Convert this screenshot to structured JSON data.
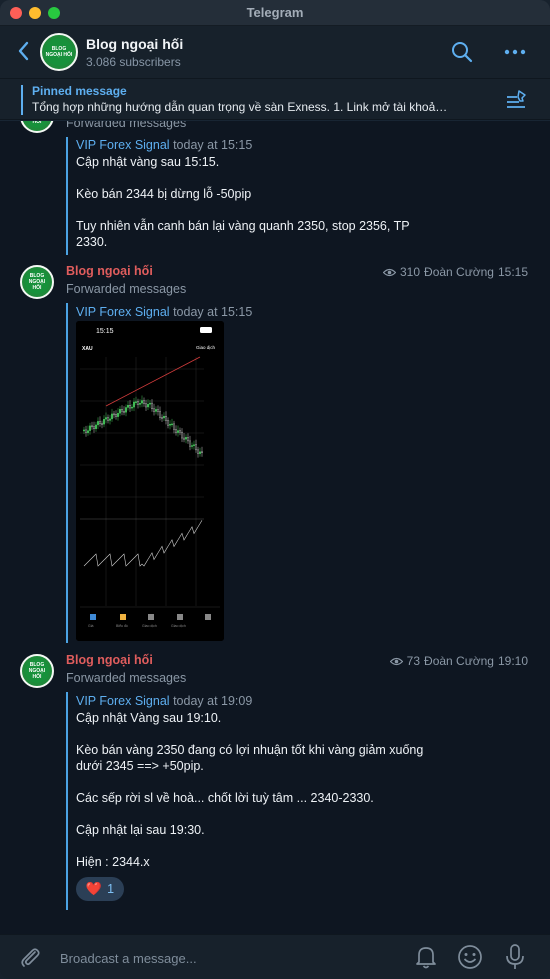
{
  "window": {
    "title": "Telegram"
  },
  "header": {
    "channel_name": "Blog ngoại hối",
    "subscribers": "3.086 subscribers",
    "avatar_text": "BLOG NGOẠI HỐI"
  },
  "pinned": {
    "label": "Pinned message",
    "text": "Tổng hợp những hướng dẫn quan trọng về sàn Exness.  1. Link mở tài khoả…"
  },
  "messages": [
    {
      "forwarded_label": "Forwarded messages",
      "source": "VIP Forex Signal",
      "source_time": "today at 15:15",
      "lines": [
        "Cập nhật vàng sau 15:15.",
        "Kèo bán 2344 bị dừng lỗ -50pip",
        "Tuy nhiên vẫn canh bán lại vàng quanh 2350, stop 2356, TP",
        "2330."
      ]
    },
    {
      "sender": "Blog ngoại hối",
      "forwarded_label": "Forwarded messages",
      "views": "310",
      "author": "Đoàn Cường",
      "time": "15:15",
      "source": "VIP Forex Signal",
      "source_time": "today at 15:15",
      "image": {
        "status_time": "15:15",
        "symbol": "XAU",
        "trade_label": "Giao dịch",
        "tabs": [
          "Giá",
          "Biểu đồ",
          "Giao dịch",
          "Giao dịch"
        ]
      }
    },
    {
      "sender": "Blog ngoại hối",
      "forwarded_label": "Forwarded messages",
      "views": "73",
      "author": "Đoàn Cường",
      "time": "19:10",
      "source": "VIP Forex Signal",
      "source_time": "today at 19:09",
      "lines": [
        "Cập nhật Vàng sau 19:10.",
        "Kèo bán vàng 2350 đang có lợi nhuận tốt khi vàng giảm xuống",
        "dưới 2345 ==> +50pip.",
        "Các sếp rời sl về hoà... chốt lời tuỳ tâm ... 2340-2330.",
        "Cập nhật lại sau 19:30.",
        "Hiện : 2344.x"
      ],
      "reaction": {
        "emoji": "❤️",
        "count": "1"
      }
    }
  ],
  "composer": {
    "placeholder": "Broadcast a message..."
  },
  "colors": {
    "accent": "#5eaff0",
    "sender": "#e05d5d",
    "background": "#0e1621",
    "header": "#17212b"
  },
  "icons": [
    "back-arrow-icon",
    "search-icon",
    "more-icon",
    "pinned-list-icon",
    "eye-icon",
    "paperclip-icon",
    "bell-icon",
    "emoji-icon",
    "microphone-icon"
  ]
}
